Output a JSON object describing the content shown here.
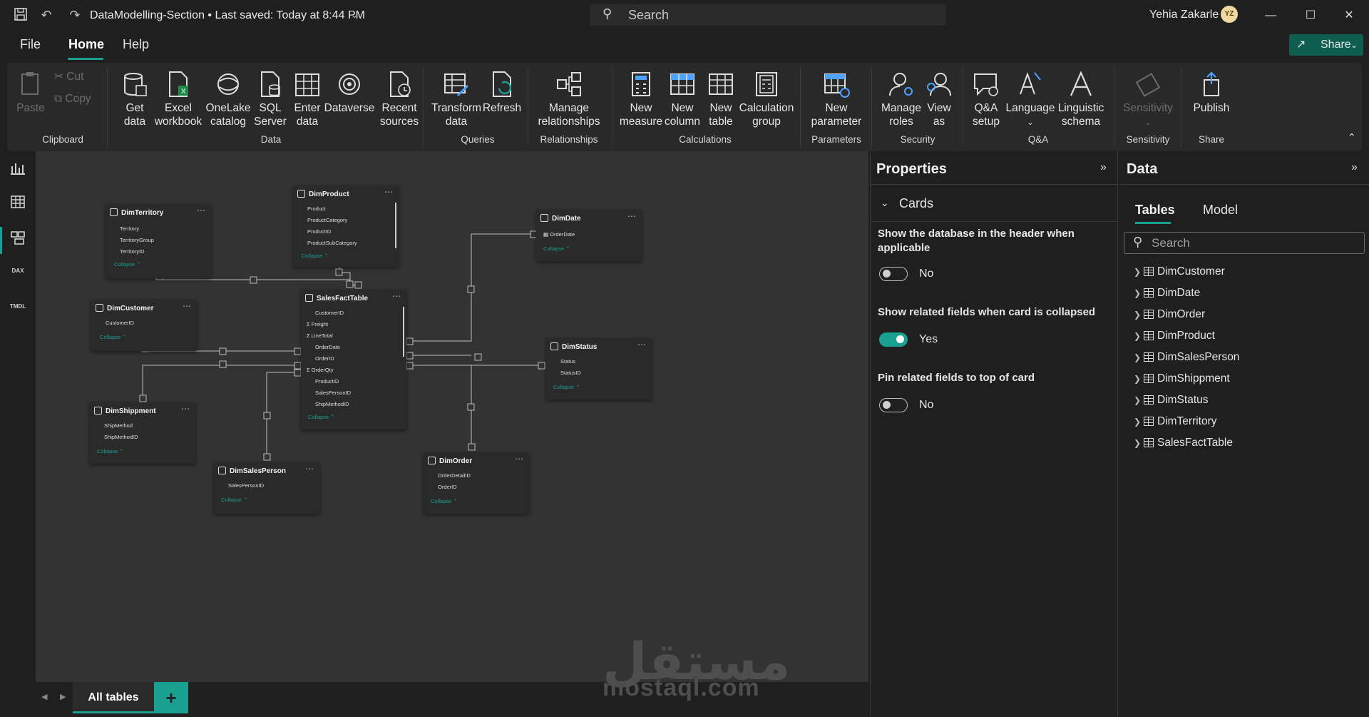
{
  "titlebar": {
    "doc_title": "DataModelling-Section  •  Last saved: Today at 8:44 PM",
    "search_placeholder": "Search",
    "user_name": "Yehia Zakarle",
    "avatar_initials": "YZ"
  },
  "menu": {
    "file": "File",
    "home": "Home",
    "help": "Help",
    "share": "Share"
  },
  "ribbon": {
    "paste": "Paste",
    "cut": "Cut",
    "copy": "Copy",
    "get_data": "Get\ndata",
    "excel": "Excel\nworkbook",
    "onelake": "OneLake\ncatalog",
    "sql": "SQL\nServer",
    "enter_data": "Enter\ndata",
    "dataverse": "Dataverse",
    "recent": "Recent\nsources",
    "transform": "Transform\ndata",
    "refresh": "Refresh",
    "manage_rel": "Manage\nrelationships",
    "new_measure": "New\nmeasure",
    "new_column": "New\ncolumn",
    "new_table": "New\ntable",
    "calc_group": "Calculation\ngroup",
    "new_param": "New\nparameter",
    "manage_roles": "Manage\nroles",
    "view_as": "View\nas",
    "qa_setup": "Q&A\nsetup",
    "language": "Language",
    "linguistic": "Linguistic\nschema",
    "sensitivity": "Sensitivity",
    "publish": "Publish",
    "groups": {
      "clipboard": "Clipboard",
      "data": "Data",
      "queries": "Queries",
      "relationships": "Relationships",
      "calculations": "Calculations",
      "parameters": "Parameters",
      "security": "Security",
      "qa": "Q&A",
      "sensitivity": "Sensitivity",
      "share": "Share"
    }
  },
  "rail": {
    "dax": "DAX",
    "tmdl": "TMDL"
  },
  "model": {
    "collapse_label": "Collapse",
    "tables": {
      "DimTerritory": {
        "name": "DimTerritory",
        "fields": [
          "Territory",
          "TerritoryGroup",
          "TerritoryID"
        ]
      },
      "DimProduct": {
        "name": "DimProduct",
        "fields": [
          "Product",
          "ProductCategory",
          "ProductID",
          "ProductSubCategory"
        ]
      },
      "DimDate": {
        "name": "DimDate",
        "fields": [
          "OrderDate"
        ]
      },
      "DimCustomer": {
        "name": "DimCustomer",
        "fields": [
          "CustomerID"
        ]
      },
      "SalesFactTable": {
        "name": "SalesFactTable",
        "fields": [
          "CustomerID",
          "Freight",
          "LineTotal",
          "OrderDate",
          "OrderID",
          "OrderQty",
          "ProductID",
          "SalesPersonID",
          "ShipMethodID"
        ]
      },
      "DimStatus": {
        "name": "DimStatus",
        "fields": [
          "Status",
          "StatusID"
        ]
      },
      "DimShippment": {
        "name": "DimShippment",
        "fields": [
          "ShipMethod",
          "ShipMethodID"
        ]
      },
      "DimSalesPerson": {
        "name": "DimSalesPerson",
        "fields": [
          "SalesPersonID"
        ]
      },
      "DimOrder": {
        "name": "DimOrder",
        "fields": [
          "OrderDetailID",
          "OrderID"
        ]
      }
    }
  },
  "bottom": {
    "tab_all": "All tables",
    "add": "+"
  },
  "properties": {
    "title": "Properties",
    "section": "Cards",
    "items": [
      {
        "label": "Show the database in the header when applicable",
        "value": "No",
        "on": false
      },
      {
        "label": "Show related fields when card is collapsed",
        "value": "Yes",
        "on": true
      },
      {
        "label": "Pin related fields to top of card",
        "value": "No",
        "on": false
      }
    ]
  },
  "data_pane": {
    "title": "Data",
    "tab_tables": "Tables",
    "tab_model": "Model",
    "search_placeholder": "Search",
    "tables": [
      "DimCustomer",
      "DimDate",
      "DimOrder",
      "DimProduct",
      "DimSalesPerson",
      "DimShippment",
      "DimStatus",
      "DimTerritory",
      "SalesFactTable"
    ]
  },
  "watermark": {
    "arabic": "مستقل",
    "latin": "mostaql.com"
  },
  "colors": {
    "accent": "#1aa090",
    "background": "#1f1f1f",
    "canvas": "#333333",
    "card": "#2a2a2a"
  }
}
